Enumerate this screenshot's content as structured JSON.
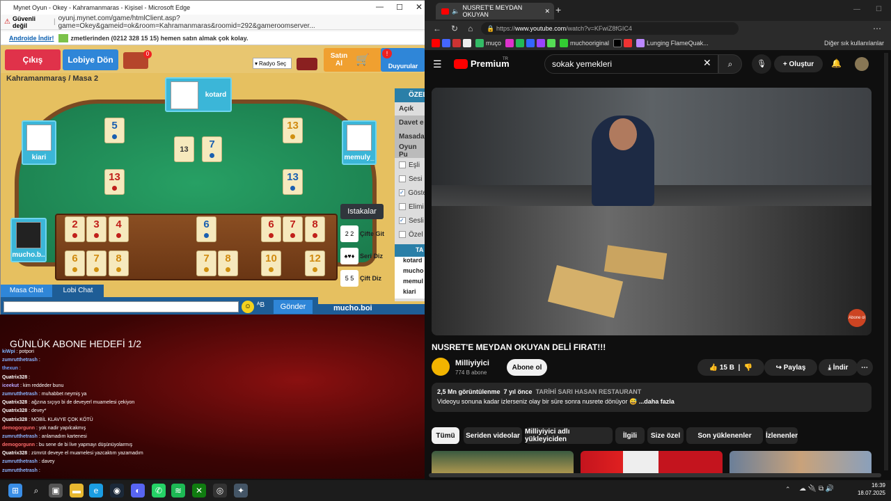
{
  "left_window": {
    "title": "Mynet Oyun - Okey - Kahramanmaras - Kişisel - Microsoft Edge",
    "security": "Güvenli değil",
    "url": "oyunj.mynet.com/game/htmlClient.asp?game=Okey&gameid=ok&room=Kahramanmaras&roomid=292&gameroomserver...",
    "ad_badge": "Androide İndir!",
    "ad_text": "zmetlerinden (0212 328 15 15) hemen satın almak çok kolay."
  },
  "game": {
    "exit_label": "Çıkış",
    "lobby_label": "Lobiye Dön",
    "chest_badge": "0",
    "radio_label": "Radyo Seç",
    "buy_label": "Satın Al",
    "announce_label": "Duyurular",
    "location": "Kahramanmaraş / Masa 2",
    "players": {
      "top": "kotard",
      "left": "kiari",
      "right": "memuly_",
      "self": "mucho.b.."
    },
    "table_tiles": [
      {
        "v": "5",
        "c": "blu"
      },
      {
        "v": "13",
        "c": "yel"
      },
      {
        "v": "13",
        "c": "red"
      },
      {
        "v": "13",
        "c": "blu"
      }
    ],
    "center": {
      "remaining": "13",
      "indicator": "7",
      "indicator_color": "blu"
    },
    "rack_top": [
      {
        "v": "2",
        "c": "red"
      },
      {
        "v": "3",
        "c": "red"
      },
      {
        "v": "4",
        "c": "red"
      },
      {
        "v": "6",
        "c": "blu"
      },
      {
        "v": "6",
        "c": "red"
      },
      {
        "v": "7",
        "c": "red"
      },
      {
        "v": "8",
        "c": "red"
      }
    ],
    "rack_bottom": [
      {
        "v": "6",
        "c": "yel"
      },
      {
        "v": "7",
        "c": "yel"
      },
      {
        "v": "8",
        "c": "yel"
      },
      {
        "v": "7",
        "c": "yel"
      },
      {
        "v": "8",
        "c": "yel"
      },
      {
        "v": "10",
        "c": "yel"
      },
      {
        "v": "12",
        "c": "yel"
      }
    ],
    "istakalar": "Istakalar",
    "combos": [
      {
        "label": "Çifte Git",
        "icon": "2 2"
      },
      {
        "label": "Seri Diz",
        "icon": "♠♥♦"
      },
      {
        "label": "Çift Diz",
        "icon": "5 5"
      }
    ],
    "right_panel": {
      "header": "ÖZEL",
      "items": [
        "Açık",
        "Davet e",
        "Masada",
        "Oyun Pu"
      ],
      "checks": [
        {
          "label": "Eşli",
          "on": false
        },
        {
          "label": "Sesi",
          "on": false
        },
        {
          "label": "Göste",
          "on": true
        },
        {
          "label": "Elimi",
          "on": false
        },
        {
          "label": "Sesli",
          "on": true
        },
        {
          "label": "Özel",
          "on": false
        }
      ],
      "table_header": "TA",
      "players": [
        "kotard",
        "mucho",
        "memul",
        "kiari"
      ]
    },
    "chat_tabs": [
      "Masa Chat",
      "Lobi Chat"
    ],
    "send_label": "Gönder",
    "self_footer": "mucho.boi"
  },
  "stream": {
    "goal": "GÜNLÜK ABONE HEDEFİ 1/2",
    "chat": [
      {
        "user": "kiWpi",
        "msg": "potpori",
        "color": "#7fb6ff"
      },
      {
        "user": "zumrutthetrash",
        "msg": "",
        "color": "#8ab4ff"
      },
      {
        "user": "thexun",
        "msg": "",
        "color": "#6fa0ff"
      },
      {
        "user": "Quatrix328",
        "msg": "",
        "color": "#fff"
      },
      {
        "user": "iceekut",
        "msg": "kim reddeder bunu",
        "color": "#b9a6ff"
      },
      {
        "user": "zumrutthetrash",
        "msg": "muhabbet neymiş ya",
        "color": "#8ab4ff"
      },
      {
        "user": "Quatrix328",
        "msg": "ağzına sıçıyo bi de deveyerl muamelesi çekiyon",
        "color": "#fff"
      },
      {
        "user": "Quatrix328",
        "msg": "devey*",
        "color": "#fff"
      },
      {
        "user": "Quatrix328",
        "msg": "MOBİL KLAVYE ÇOK KÖTÜ",
        "color": "#fff"
      },
      {
        "user": "demogorgunn",
        "msg": "yok nadir yapılcakmış",
        "color": "#ff6b6b"
      },
      {
        "user": "zumrutthetrash",
        "msg": "anlamadım kartenesi",
        "color": "#8ab4ff"
      },
      {
        "user": "demogorgunn",
        "msg": "bu sene de bi live yapmayı düşünüyolarmış",
        "color": "#ff6b6b"
      },
      {
        "user": "Quatrix328",
        "msg": "zümrüt deveye el muamelesi yazcaktım yazamadım",
        "color": "#fff"
      },
      {
        "user": "zumrutthetrash",
        "msg": "davey",
        "color": "#8ab4ff"
      },
      {
        "user": "zumrutthetrash",
        "msg": "",
        "color": "#8ab4ff"
      }
    ]
  },
  "right_window": {
    "tab_title": "NUSRET'E MEYDAN OKUYAN",
    "url_prefix": "https://",
    "url_domain": "www.youtube.com",
    "url_path": "/watch?v=KFwiZ8fGIC4",
    "bookmarks": [
      "muço",
      "muchooriginal",
      "Lunging FlameQuak..."
    ],
    "other_bookmarks": "Diğer sık kullanılanlar",
    "premium": "Premium",
    "premium_region": "TR",
    "search_value": "sokak yemekleri",
    "create_label": "Oluştur",
    "video_watermark": "Abone ol",
    "video_title": "NUSRET'E MEYDAN OKUYAN DELİ FIRAT!!!",
    "channel": "Milliyiyici",
    "subs": "774 B abone",
    "subscribe": "Abone ol",
    "likes": "15 B",
    "share": "Paylaş",
    "download": "İndir",
    "views": "2,5 Mn görüntülenme",
    "ago": "7 yıl önce",
    "place": "TARİHİ SARI HASAN RESTAURANT",
    "description": "Videoyu sonuna kadar izlerseniz olay bir süre sonra nusrete dönüyor",
    "more": "...daha fazla",
    "chips": [
      "Tümü",
      "Seriden videolar",
      "Milliyiyici adlı yükleyiciden",
      "İlgili",
      "Size özel",
      "Son yüklenenler",
      "İzlenenler"
    ]
  },
  "taskbar": {
    "time": "16:39",
    "date": "18.07.2025"
  },
  "colors": {
    "felt": "#1e8a58",
    "red_button": "#e0324a",
    "blue_button": "#2f86d8",
    "yt_red": "#ff0000"
  }
}
